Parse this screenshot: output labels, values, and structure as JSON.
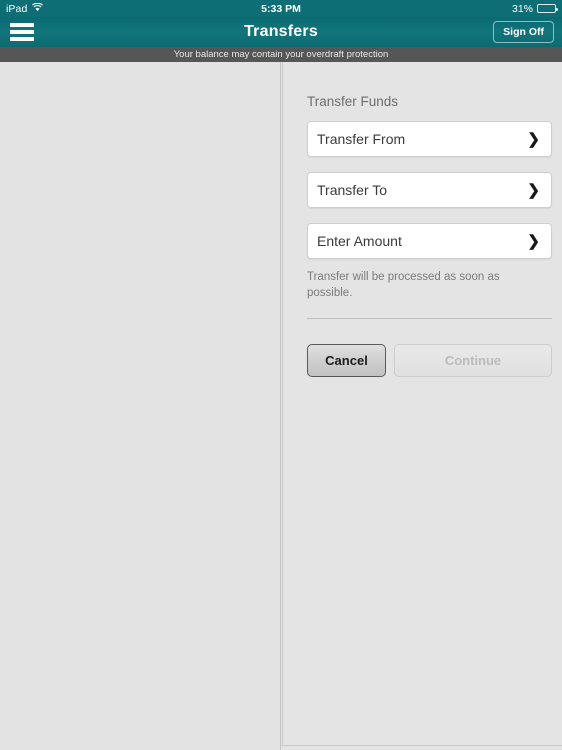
{
  "status_bar": {
    "device": "iPad",
    "wifi_icon": "wifi-icon",
    "time": "5:33 PM",
    "battery_percent": "31%",
    "battery_level": 31
  },
  "nav_bar": {
    "menu_icon": "hamburger-menu-icon",
    "title": "Transfers",
    "sign_off_label": "Sign Off"
  },
  "banner": {
    "message": "Your balance may contain your overdraft protection"
  },
  "panel": {
    "section_title": "Transfer Funds",
    "fields": [
      {
        "label": "Transfer From",
        "value": "",
        "chevron": "❯"
      },
      {
        "label": "Transfer To",
        "value": "",
        "chevron": "❯"
      },
      {
        "label": "Enter Amount",
        "value": "",
        "chevron": "❯"
      }
    ],
    "helper_text": "Transfer will be processed as soon as possible.",
    "buttons": {
      "cancel_label": "Cancel",
      "continue_label": "Continue",
      "continue_enabled": false
    }
  },
  "colors": {
    "brand_teal": "#0e6e75",
    "banner_gray": "#565656",
    "page_background": "#e3e3e3",
    "field_background": "#ffffff"
  }
}
